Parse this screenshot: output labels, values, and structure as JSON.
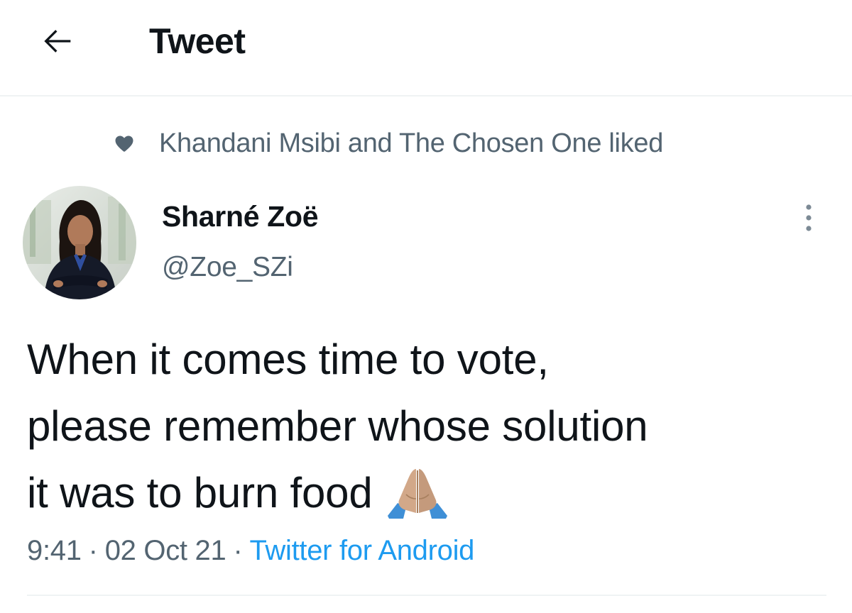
{
  "header": {
    "back_icon": "arrow-left-icon",
    "title": "Tweet"
  },
  "social_context": {
    "icon": "heart-icon",
    "text": "Khandani Msibi and The Chosen One liked"
  },
  "author": {
    "name": "Sharné Zoë",
    "handle": "@Zoe_SZi",
    "avatar": "avatar-photo"
  },
  "tweet": {
    "lines": [
      "When it comes time to vote,",
      "please remember whose solution",
      "it was to burn food"
    ],
    "emoji": "folded-hands-emoji"
  },
  "meta": {
    "time": "9:41",
    "separator": "·",
    "date": "02 Oct 21",
    "source": "Twitter for Android"
  },
  "colors": {
    "primary_text": "#0f1419",
    "secondary_text": "#536471",
    "link": "#1d9bf0",
    "divider": "#eff3f4"
  }
}
